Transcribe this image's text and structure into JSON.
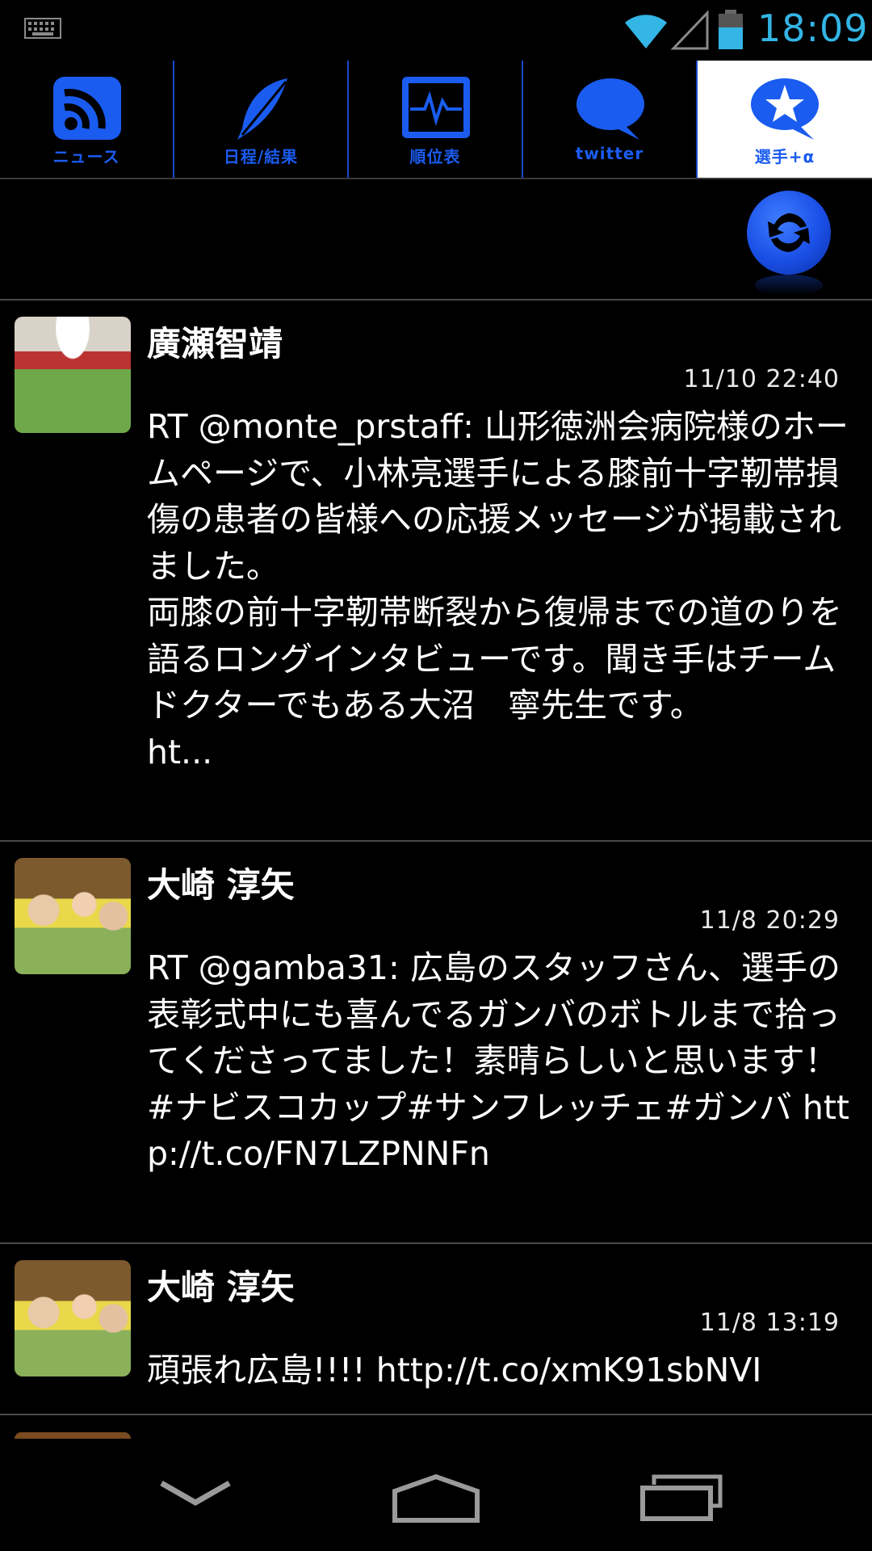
{
  "status_bar": {
    "time": "18:09",
    "icons": [
      "keyboard-icon",
      "wifi-icon",
      "signal-icon",
      "battery-icon"
    ],
    "accent_color": "#33b5e5"
  },
  "tabs": [
    {
      "label": "ニュース",
      "icon": "rss-icon",
      "active": false
    },
    {
      "label": "日程/結果",
      "icon": "feather-icon",
      "active": false
    },
    {
      "label": "順位表",
      "icon": "chart-monitor-icon",
      "active": false
    },
    {
      "label": "twitter",
      "icon": "speech-bubble-icon",
      "active": false
    },
    {
      "label": "選手+α",
      "icon": "star-bubble-icon",
      "active": true
    }
  ],
  "toolbar": {
    "refresh_icon": "refresh-icon"
  },
  "tweets": [
    {
      "author": "廣瀬智靖",
      "time": "11/10 22:40",
      "body": "RT @monte_prstaff: 山形徳洲会病院様のホームページで、小林亮選手による膝前十字靭帯損傷の患者の皆様への応援メッセージが掲載されました。\n両膝の前十字靭帯断裂から復帰までの道のりを語るロングインタビューです。聞き手はチームドクターでもある大沼　寧先生です。\nht..."
    },
    {
      "author": "大崎 淳矢",
      "time": "11/8 20:29",
      "body": "RT @gamba31: 広島のスタッフさん、選手の表彰式中にも喜んでるガンバのボトルまで拾ってくださってました！素晴らしいと思います！#ナビスコカップ#サンフレッチェ#ガンバ http://t.co/FN7LZPNNFn"
    },
    {
      "author": "大崎 淳矢",
      "time": "11/8 13:19",
      "body": "頑張れ広島!!!! http://t.co/xmK91sbNVI"
    }
  ],
  "nav_bar": {
    "icons": [
      "back-icon",
      "home-icon",
      "recent-apps-icon"
    ]
  },
  "colors": {
    "tab_blue": "#1a5cf0",
    "divider": "#4a4a4a",
    "background": "#000000"
  }
}
